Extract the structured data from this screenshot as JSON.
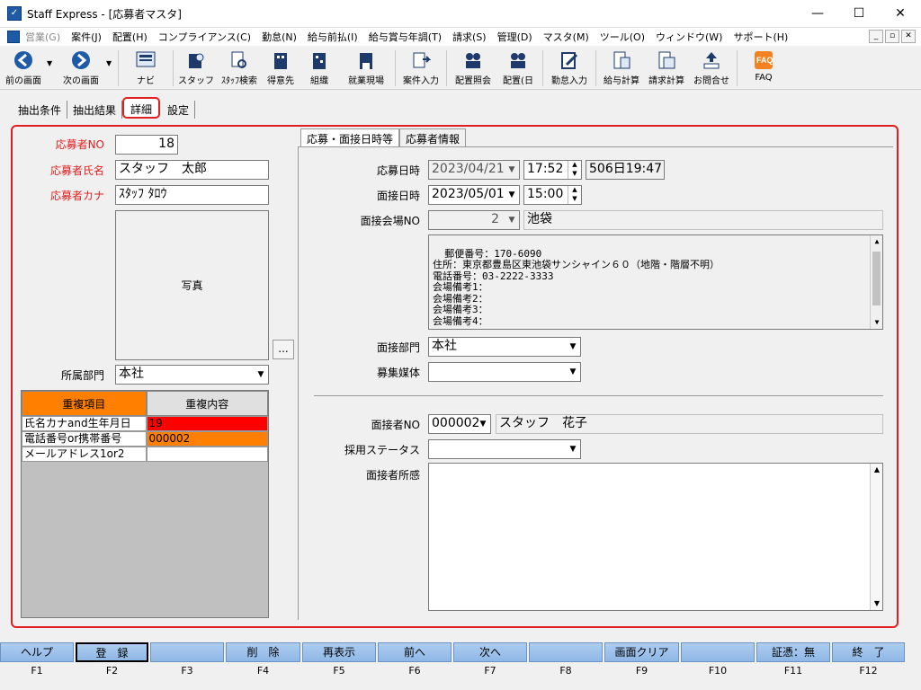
{
  "window": {
    "title": "Staff Express - [応募者マスタ]",
    "minimize": "—",
    "maximize": "☐",
    "close": "✕"
  },
  "menu": [
    "営業(G)",
    "案件(J)",
    "配置(H)",
    "コンプライアンス(C)",
    "勤怠(N)",
    "給与前払(I)",
    "給与賞与年調(T)",
    "請求(S)",
    "管理(D)",
    "マスタ(M)",
    "ツール(O)",
    "ウィンドウ(W)",
    "サポート(H)"
  ],
  "mdi_buttons": [
    "_",
    "▫",
    "✕"
  ],
  "toolbar": {
    "back": "前の画面",
    "forward": "次の画面",
    "navi": "ナビ",
    "staff": "スタッフ",
    "staff_search": "ｽﾀｯﾌ検索",
    "client": "得意先",
    "org": "組織",
    "worksite": "就業現場",
    "case_input": "案件入力",
    "placement_inquiry": "配置照会",
    "placement_day": "配置(日",
    "attendance": "勤怠入力",
    "payroll": "給与計算",
    "billing": "請求計算",
    "contact": "お問合せ",
    "faq": "FAQ"
  },
  "tabs": [
    "抽出条件",
    "抽出結果",
    "詳細",
    "設定"
  ],
  "left": {
    "applicant_no_label": "応募者NO",
    "applicant_no": "18",
    "name_label": "応募者氏名",
    "name": "スタッフ　太郎",
    "kana_label": "応募者カナ",
    "kana": "ｽﾀｯﾌ ﾀﾛｳ",
    "photo_label": "写真",
    "ellipsis": "...",
    "dept_label": "所属部門",
    "dept": "本社",
    "dup_header": [
      "重複項目",
      "重複内容"
    ],
    "dup_rows": [
      {
        "item": "氏名カナand生年月日",
        "value": "19"
      },
      {
        "item": "電話番号or携帯番号",
        "value": "000002"
      },
      {
        "item": "メールアドレス1or2",
        "value": ""
      }
    ]
  },
  "inner_tabs": [
    "応募・面接日時等",
    "応募者情報"
  ],
  "right": {
    "apply_date_label": "応募日時",
    "apply_date": "2023/04/21",
    "apply_time": "17:52",
    "elapsed": "506日19:47",
    "interview_date_label": "面接日時",
    "interview_date": "2023/05/01",
    "interview_time": "15:00",
    "venue_label": "面接会場NO",
    "venue_no": "2",
    "venue_name": "池袋",
    "venue_info": "郵便番号：170-6090\n住所：東京都豊島区東池袋サンシャイン６０（地階・階層不明）\n電話番号：03-2222-3333\n会場備考1：\n会場備考2：\n会場備考3：\n会場備考4：",
    "interview_dept_label": "面接部門",
    "interview_dept": "本社",
    "media_label": "募集媒体",
    "media": "",
    "interviewer_label": "面接者NO",
    "interviewer_no": "000002",
    "interviewer_name": "スタッフ　花子",
    "status_label": "採用ステータス",
    "status": "",
    "impression_label": "面接者所感",
    "impression": ""
  },
  "fkeys": [
    {
      "label": "ヘルプ",
      "key": "F1"
    },
    {
      "label": "登　録",
      "key": "F2"
    },
    {
      "label": "",
      "key": "F3"
    },
    {
      "label": "削　除",
      "key": "F4"
    },
    {
      "label": "再表示",
      "key": "F5"
    },
    {
      "label": "前へ",
      "key": "F6"
    },
    {
      "label": "次へ",
      "key": "F7"
    },
    {
      "label": "",
      "key": "F8"
    },
    {
      "label": "画面クリア",
      "key": "F9"
    },
    {
      "label": "",
      "key": "F10"
    },
    {
      "label": "証憑：無",
      "key": "F11"
    },
    {
      "label": "終　了",
      "key": "F12"
    }
  ],
  "colors": {
    "highlight_red": "#e02020",
    "dup_red": "#ff0000",
    "dup_orange": "#ff8000",
    "fkey_blue": "#9ec2ec"
  }
}
